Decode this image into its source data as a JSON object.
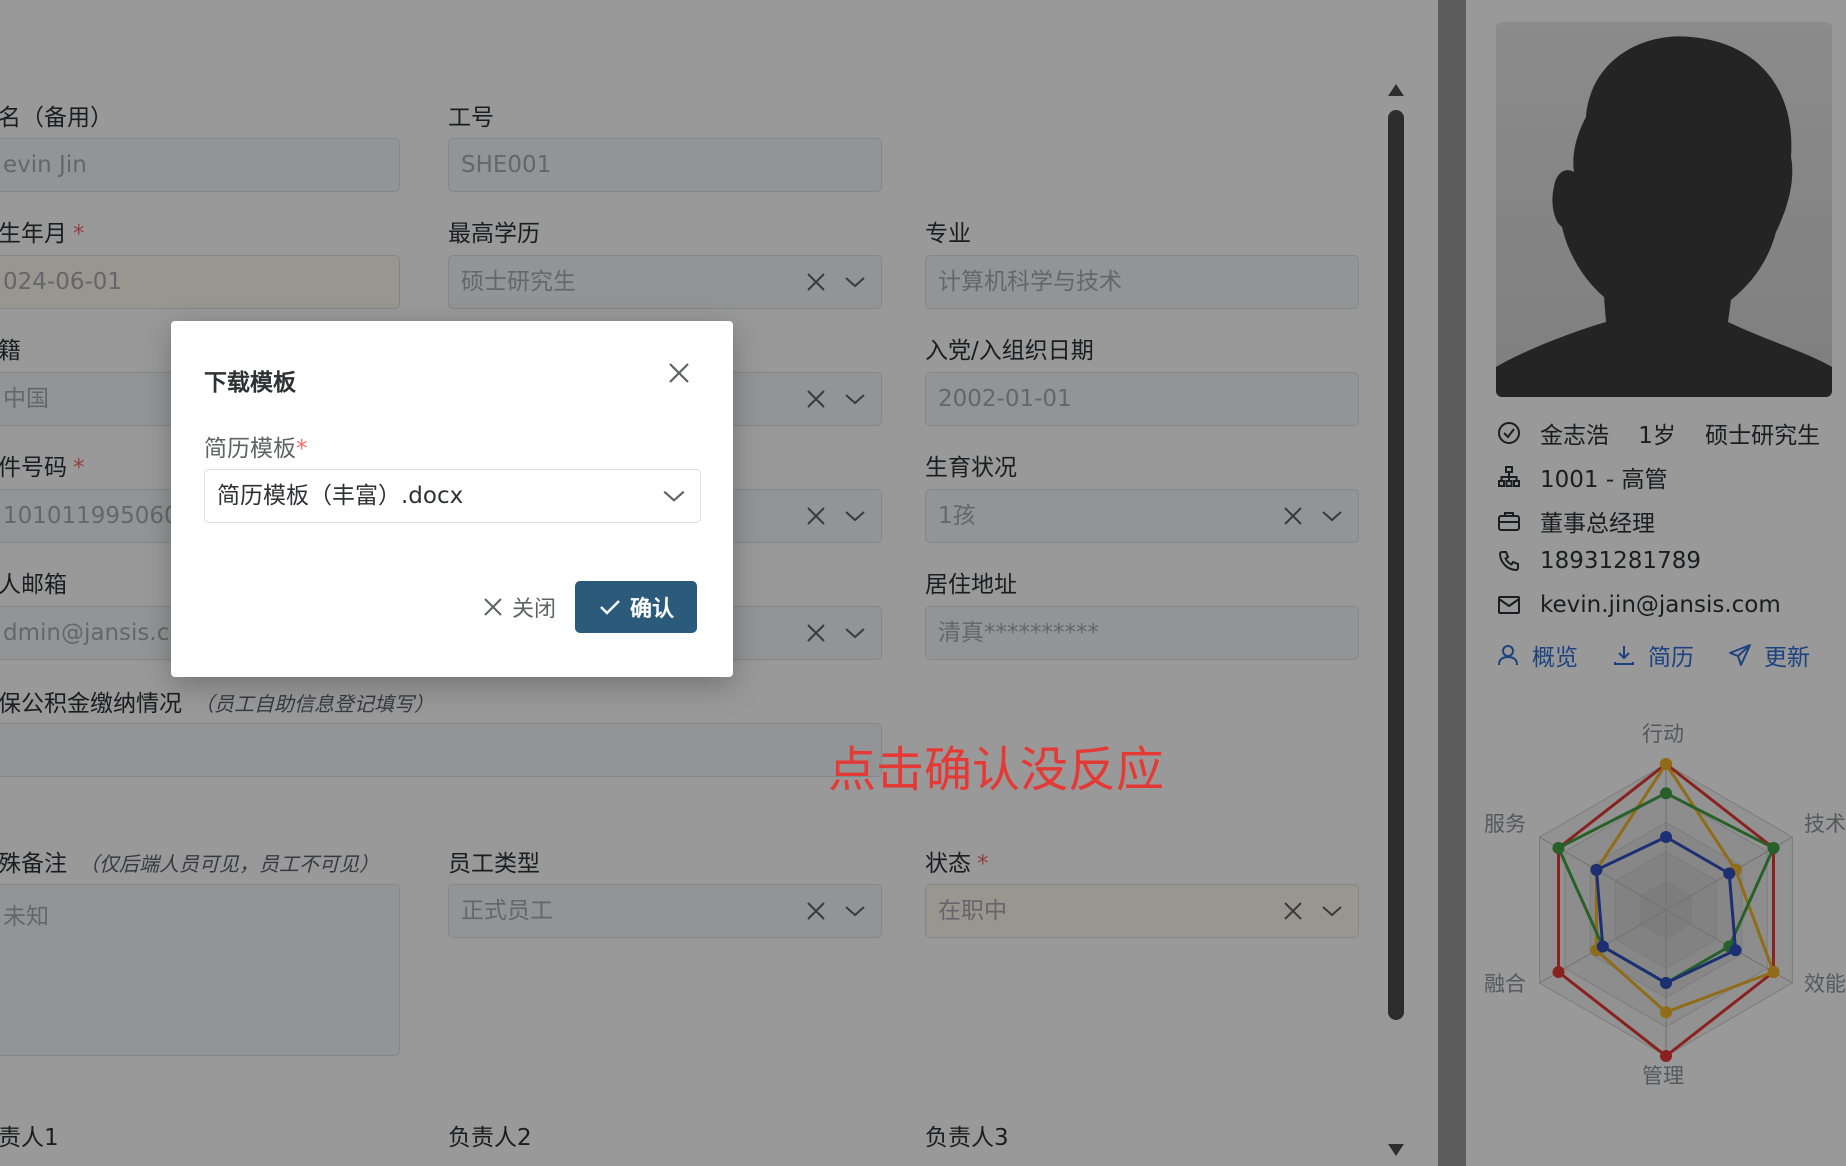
{
  "form": {
    "fields": [
      {
        "label": "名（备用）",
        "value": "evin Jin",
        "hint": ""
      },
      {
        "label": "工号",
        "value": "SHE001"
      },
      {
        "label": "生年月",
        "required": "*",
        "value": "024-06-01"
      },
      {
        "label": "最高学历",
        "value": "硕士研究生"
      },
      {
        "label": "专业",
        "value": "计算机科学与技术"
      },
      {
        "label": "籍",
        "value": "中国"
      },
      {
        "label": "入党/入组织日期",
        "value": "2002-01-01"
      },
      {
        "label": "件号码",
        "required": "*",
        "value": "10101199506051"
      },
      {
        "label": "生育状况",
        "value": "1孩"
      },
      {
        "label": "人邮箱",
        "value": "dmin@jansis.com"
      },
      {
        "label": "居住地址",
        "value": "清真**********"
      },
      {
        "label": "保公积金缴纳情况",
        "hint": "（员工自助信息登记填写）"
      },
      {
        "label": "殊备注",
        "hint": "（仅后端人员可见，员工不可见）",
        "value": "未知"
      },
      {
        "label": "员工类型",
        "value": "正式员工"
      },
      {
        "label": "状态",
        "required": "*",
        "value": "在职中"
      },
      {
        "label": "责人1"
      },
      {
        "label": "负责人2"
      },
      {
        "label": "负责人3"
      }
    ]
  },
  "profile": {
    "name_line": "金志浩    1岁    硕士研究生",
    "dept": "1001 - 高管",
    "title": "董事总经理",
    "phone": "18931281789",
    "email": "kevin.jin@jansis.com",
    "actions": [
      "概览",
      "简历",
      "更新"
    ],
    "radar": {
      "labels": [
        "行动",
        "技术",
        "效能",
        "管理",
        "融合",
        "服务"
      ]
    }
  },
  "chart_data": {
    "type": "radar",
    "axes": [
      "行动",
      "技术",
      "效能",
      "管理",
      "融合",
      "服务"
    ],
    "series": [
      {
        "color": "#e53935",
        "values": [
          1.0,
          0.85,
          0.85,
          1.0,
          0.85,
          0.85
        ]
      },
      {
        "color": "#f0b429",
        "values": [
          1.0,
          0.55,
          0.85,
          0.7,
          0.55,
          0.55
        ]
      },
      {
        "color": "#43a047",
        "values": [
          0.8,
          0.85,
          0.5,
          0.5,
          0.5,
          0.85
        ]
      },
      {
        "color": "#2e4fbf",
        "values": [
          0.5,
          0.5,
          0.55,
          0.5,
          0.5,
          0.55
        ]
      }
    ],
    "range": [
      0,
      1
    ]
  },
  "dialog": {
    "title": "下载模板",
    "field_label": "简历模板",
    "required": "*",
    "selected": "简历模板（丰富）.docx",
    "cancel_label": "关闭",
    "ok_label": "确认"
  },
  "annotation": "点击确认没反应",
  "colors": {
    "accent": "#2f6fd6",
    "primary_button": "#2b5a7a",
    "required": "#f56c6c",
    "annotation": "#e53935"
  }
}
